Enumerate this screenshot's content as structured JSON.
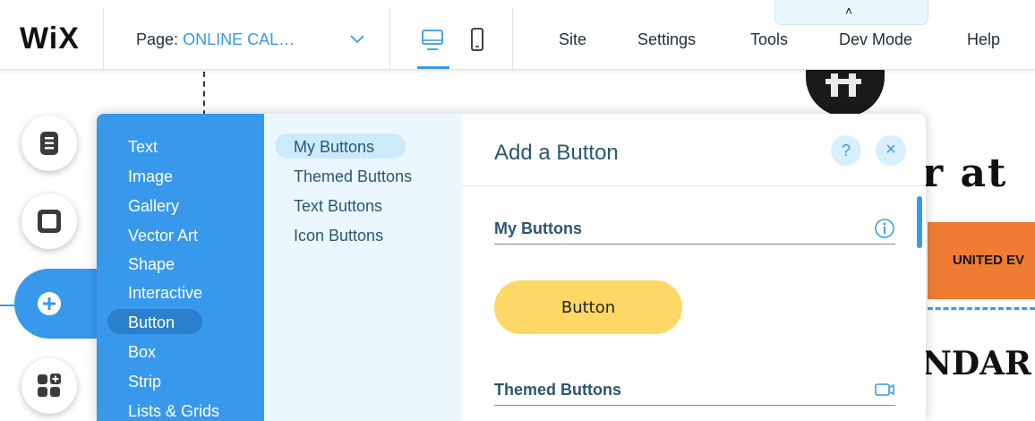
{
  "topbar": {
    "logo": "WiX",
    "page_label": "Page:",
    "page_name": "ONLINE CAL…",
    "collapse_glyph": "˄",
    "menu": [
      "Site",
      "Settings",
      "Tools",
      "Dev Mode",
      "Help"
    ]
  },
  "site_preview": {
    "heading_fragment": "r at",
    "band_text": "UNITED EV",
    "heading_fragment_2": "NDAR"
  },
  "rail": {
    "items": [
      "pages-icon",
      "background-icon",
      "add-icon",
      "app-market-icon"
    ],
    "active": "add-icon"
  },
  "add_panel": {
    "categories": [
      "Text",
      "Image",
      "Gallery",
      "Vector Art",
      "Shape",
      "Interactive",
      "Button",
      "Box",
      "Strip",
      "Lists & Grids"
    ],
    "selected_category": "Button",
    "subcategories": [
      "My Buttons",
      "Themed Buttons",
      "Text Buttons",
      "Icon Buttons"
    ],
    "selected_subcategory": "My Buttons",
    "title": "Add a Button",
    "help_glyph": "?",
    "close_glyph": "×",
    "sections": [
      {
        "label": "My Buttons",
        "icon": "info-icon"
      },
      {
        "label": "Themed Buttons",
        "icon": "video-icon"
      }
    ],
    "sample_button_label": "Button"
  },
  "colors": {
    "accent": "#3899ec",
    "panel_light": "#eaf7ff",
    "sample_button": "#fed866",
    "site_band": "#f07b32"
  }
}
